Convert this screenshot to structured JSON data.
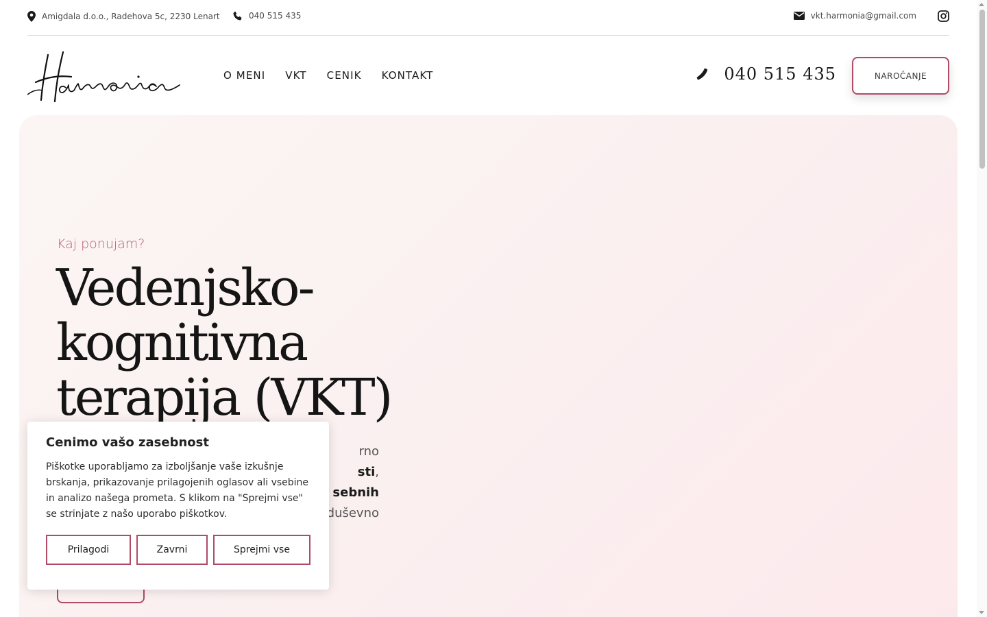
{
  "topbar": {
    "address": "Amigdala d.o.o., Radehova 5c, 2230 Lenart",
    "phone": "040 515 435",
    "email": "vkt.harmonia@gmail.com",
    "icons": [
      "location-pin-icon",
      "phone-icon",
      "envelope-icon",
      "instagram-icon"
    ]
  },
  "header": {
    "logo_text": "Harmonia",
    "nav": [
      "O MENI",
      "VKT",
      "CENIK",
      "KONTAKT"
    ],
    "phone": "040 515 435",
    "cta": "NAROČANJE"
  },
  "hero": {
    "kicker": "Kaj ponujam?",
    "title": "Vedenjsko-kognitivna terapija (VKT)",
    "text_parts": [
      "rno",
      "sti",
      ",",
      "sebnih",
      "duševno"
    ]
  },
  "cookie": {
    "title": "Cenimo vašo zasebnost",
    "body": "Piškotke uporabljamo za izboljšanje vaše izkušnje brskanja, prikazovanje prilagojenih oglasov ali vsebine in analizo našega prometa. S klikom na \"Sprejmi vse\" se strinjate z našo uporabo piškotkov.",
    "buttons": [
      "Prilagodi",
      "Zavrni",
      "Sprejmi vse"
    ]
  },
  "colors": {
    "accent": "#b04a66",
    "kicker": "#b8587a",
    "hero_bg": "#fbeff0"
  }
}
